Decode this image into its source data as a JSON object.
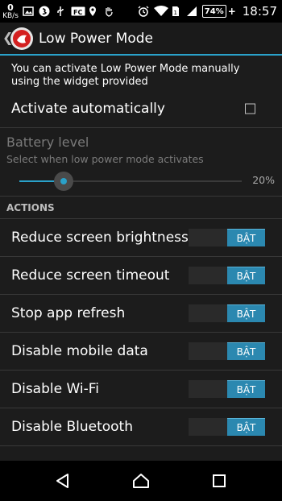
{
  "status_bar": {
    "net_speed_value": "0",
    "net_speed_unit": "KB/s",
    "battery_percent": "74%",
    "battery_plus": "+",
    "time": "18:57",
    "icons": [
      "image-icon",
      "shazam-icon",
      "usb-icon",
      "fc-icon",
      "location-icon",
      "hand-icon",
      "alarm-icon",
      "wifi-icon",
      "sim-icon",
      "signal-icon",
      "battery-icon"
    ]
  },
  "action_bar": {
    "title": "Low Power Mode"
  },
  "info_text": "You can activate Low Power Mode manually using the widget provided",
  "auto_activate": {
    "label": "Activate automatically",
    "checked": false
  },
  "battery_level": {
    "title": "Battery level",
    "subtitle": "Select when low power mode activates",
    "value_label": "20%",
    "value": 0.2
  },
  "actions": {
    "header": "ACTIONS",
    "items": [
      {
        "label": "Reduce screen brightness",
        "toggle": "BẬT"
      },
      {
        "label": "Reduce screen timeout",
        "toggle": "BẬT"
      },
      {
        "label": "Stop app refresh",
        "toggle": "BẬT"
      },
      {
        "label": "Disable mobile data",
        "toggle": "BẬT"
      },
      {
        "label": "Disable Wi-Fi",
        "toggle": "BẬT"
      },
      {
        "label": "Disable Bluetooth",
        "toggle": "BẬT"
      }
    ]
  },
  "colors": {
    "accent": "#2aa1c9",
    "toggle_on": "#2b88b0",
    "background": "#1c1c1c"
  },
  "nav": [
    "back-icon",
    "home-icon",
    "recents-icon"
  ]
}
